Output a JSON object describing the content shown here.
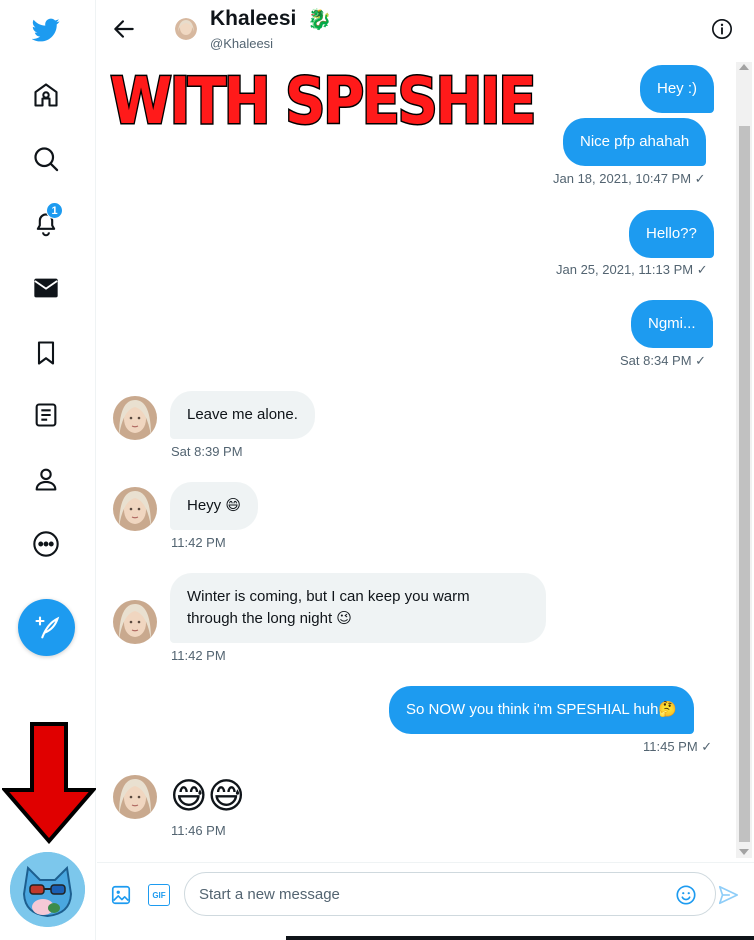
{
  "sidebar": {
    "items": [
      {
        "icon": "twitter-bird-icon"
      },
      {
        "icon": "home-icon"
      },
      {
        "icon": "explore-icon"
      },
      {
        "icon": "notifications-icon",
        "badge": "1"
      },
      {
        "icon": "messages-icon"
      },
      {
        "icon": "bookmarks-icon"
      },
      {
        "icon": "lists-icon"
      },
      {
        "icon": "profile-icon"
      },
      {
        "icon": "more-icon"
      }
    ],
    "compose_icon": "compose-tweet-icon"
  },
  "header": {
    "name": "Khaleesi",
    "name_emoji": "🐉",
    "handle": "@Khaleesi"
  },
  "messages": [
    {
      "id": "m1",
      "direction": "out",
      "text": "Hey :)"
    },
    {
      "id": "m2",
      "direction": "out",
      "text": "Nice pfp ahahah",
      "time": "Jan 18, 2021, 10:47 PM ✓"
    },
    {
      "id": "m3",
      "direction": "out",
      "text": "Hello??",
      "time": "Jan 25, 2021, 11:13 PM ✓"
    },
    {
      "id": "m4",
      "direction": "out",
      "text": "Ngmi...",
      "time": "Sat 8:34 PM ✓"
    },
    {
      "id": "m5",
      "direction": "in",
      "text": "Leave me alone.",
      "time": "Sat 8:39 PM"
    },
    {
      "id": "m6",
      "direction": "in",
      "text": "Heyy 😄",
      "time": "11:42 PM"
    },
    {
      "id": "m7",
      "direction": "in",
      "line1": "Winter is coming, but I can keep you warm",
      "line2": "through the long night 😉",
      "time": "11:42 PM"
    },
    {
      "id": "m8",
      "direction": "out",
      "text": "So NOW you think i'm SPESHIAL huh🤔",
      "time": "11:45 PM ✓"
    },
    {
      "id": "m9",
      "direction": "in",
      "text": "😅😅",
      "time": "11:46 PM"
    }
  ],
  "composer": {
    "placeholder": "Start a new message",
    "gif_label": "GIF"
  },
  "overlay": {
    "caption": "WITH SPESHIE",
    "arrow_color": "#e00000",
    "caption_color": "#ff1a1a"
  },
  "colors": {
    "accent": "#1d9bf0",
    "incoming_bubble": "#eff3f4",
    "muted_text": "#536471"
  }
}
